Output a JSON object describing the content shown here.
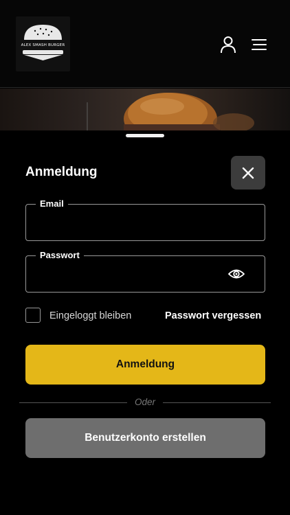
{
  "header": {
    "logo_text": "ALEX SMASH BURGER",
    "user_icon": "user-icon",
    "menu_icon": "menu-icon"
  },
  "login": {
    "title": "Anmeldung",
    "close_icon": "close-icon",
    "email": {
      "label": "Email",
      "value": "",
      "placeholder": ""
    },
    "password": {
      "label": "Passwort",
      "value": "",
      "placeholder": ""
    },
    "remember_label": "Eingeloggt bleiben",
    "remember_checked": false,
    "forgot_label": "Passwort vergessen",
    "submit_label": "Anmeldung",
    "divider_label": "Oder",
    "register_label": "Benutzerkonto erstellen"
  },
  "colors": {
    "accent": "#e4b718",
    "background": "#000000",
    "secondary_button": "#6e6e6e",
    "close_button": "#3c3c3c"
  }
}
